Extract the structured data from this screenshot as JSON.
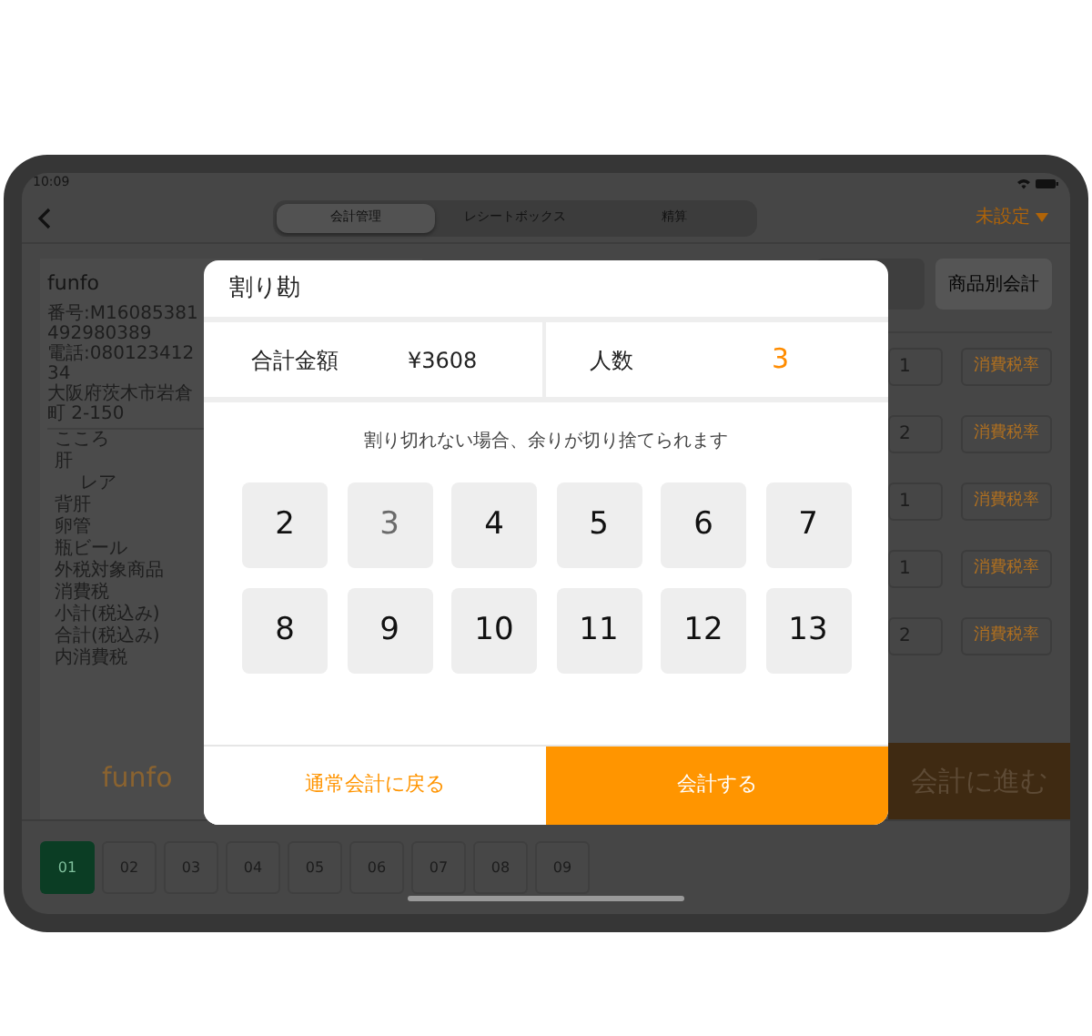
{
  "status_bar": {
    "time": "10:09"
  },
  "top_bar": {
    "tabs": [
      {
        "label": "会計管理",
        "selected": true
      },
      {
        "label": "レシートボックス",
        "selected": false
      },
      {
        "label": "精算",
        "selected": false
      }
    ],
    "store_select": {
      "label": "未設定"
    }
  },
  "receipt": {
    "store": "funfo",
    "info": [
      "番号:M16085381492980389",
      "電話:08012341234",
      "大阪府茨木市岩倉町 2-150"
    ],
    "items": [
      {
        "label": "こころ"
      },
      {
        "label": "肝",
        "children": [
          {
            "label": "レア"
          }
        ]
      },
      {
        "label": "背肝"
      },
      {
        "label": "卵管"
      },
      {
        "label": "瓶ビール"
      }
    ],
    "summary": [
      "外税対象商品",
      "消費税",
      "小計(税込み)",
      "合計(税込み)",
      "内消費税"
    ],
    "logo": "funfo"
  },
  "header_buttons": [
    "商品別会計"
  ],
  "order_rows": [
    {
      "quantity": "1",
      "tax_button": "消費税率"
    },
    {
      "quantity": "2",
      "tax_button": "消費税率"
    },
    {
      "quantity": "1",
      "tax_button": "消費税率"
    },
    {
      "quantity": "1",
      "tax_button": "消費税率"
    },
    {
      "quantity": "2",
      "tax_button": "消費税率"
    }
  ],
  "proceed_button": "会計に進む",
  "table_tabs": [
    {
      "label": "01",
      "selected": true
    },
    {
      "label": "02",
      "selected": false
    },
    {
      "label": "03",
      "selected": false
    },
    {
      "label": "04",
      "selected": false
    },
    {
      "label": "05",
      "selected": false
    },
    {
      "label": "06",
      "selected": false
    },
    {
      "label": "07",
      "selected": false
    },
    {
      "label": "08",
      "selected": false
    },
    {
      "label": "09",
      "selected": false
    }
  ],
  "dialog": {
    "title": "割り勘",
    "total_label": "合計金額",
    "total_value": "¥3608",
    "people_label": "人数",
    "people_value": "3",
    "note": "割り切れない場合、余りが切り捨てられます",
    "keys": [
      {
        "label": "2",
        "selected": false
      },
      {
        "label": "3",
        "selected": true
      },
      {
        "label": "4",
        "selected": false
      },
      {
        "label": "5",
        "selected": false
      },
      {
        "label": "6",
        "selected": false
      },
      {
        "label": "7",
        "selected": false
      },
      {
        "label": "8",
        "selected": false
      },
      {
        "label": "9",
        "selected": false
      },
      {
        "label": "10",
        "selected": false
      },
      {
        "label": "11",
        "selected": false
      },
      {
        "label": "12",
        "selected": false
      },
      {
        "label": "13",
        "selected": false
      }
    ],
    "cancel_button": "通常会計に戻る",
    "confirm_button": "会計する"
  }
}
